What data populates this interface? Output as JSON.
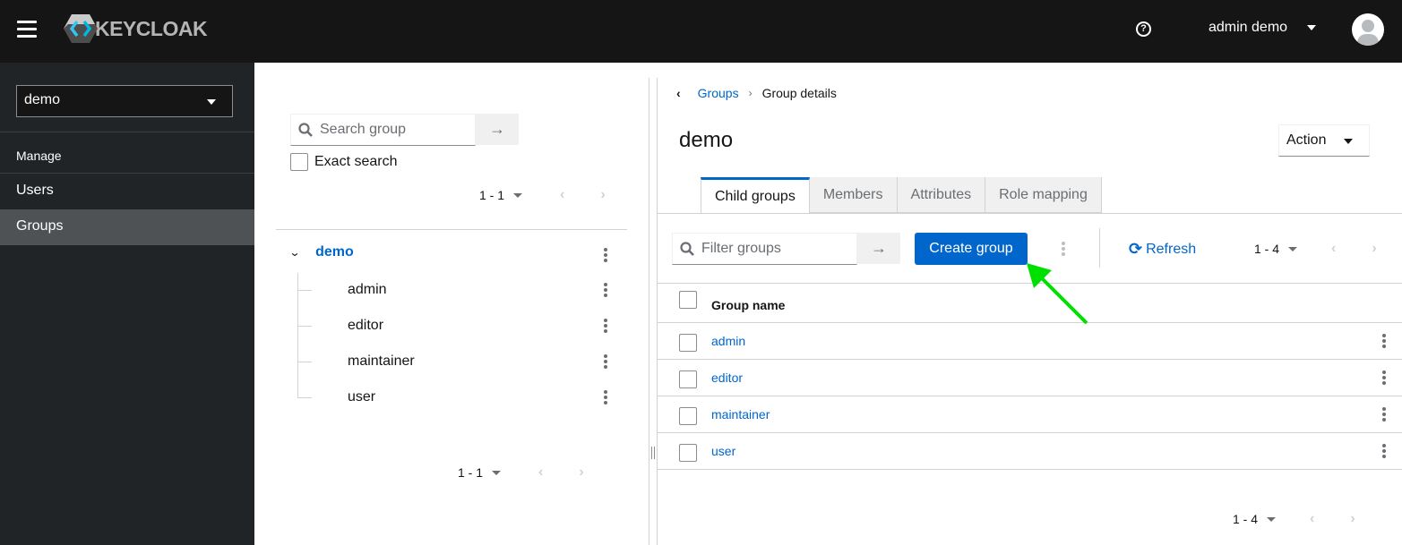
{
  "header": {
    "brand": "KEYCLOAK",
    "user_name": "admin demo"
  },
  "sidebar": {
    "realm": "demo",
    "section": "Manage",
    "items": [
      {
        "label": "Users",
        "active": false
      },
      {
        "label": "Groups",
        "active": true
      }
    ]
  },
  "tree": {
    "search_placeholder": "Search group",
    "exact_search_label": "Exact search",
    "pager_top": "1 - 1",
    "pager_bottom": "1 - 1",
    "root": "demo",
    "children": [
      "admin",
      "editor",
      "maintainer",
      "user"
    ]
  },
  "detail": {
    "breadcrumb": {
      "parent": "Groups",
      "current": "Group details"
    },
    "title": "demo",
    "action_label": "Action",
    "tabs": [
      {
        "label": "Child groups",
        "active": true
      },
      {
        "label": "Members",
        "active": false
      },
      {
        "label": "Attributes",
        "active": false
      },
      {
        "label": "Role mapping",
        "active": false
      }
    ],
    "filter_placeholder": "Filter groups",
    "create_label": "Create group",
    "refresh_label": "Refresh",
    "pager_top": "1 - 4",
    "pager_bottom": "1 - 4",
    "column_header": "Group name",
    "rows": [
      "admin",
      "editor",
      "maintainer",
      "user"
    ]
  },
  "annotation": {
    "arrow_color": "#00e000",
    "target": "Create group"
  },
  "colors": {
    "brand_blue": "#0066cc",
    "masthead": "#151515",
    "sidebar": "#212427"
  }
}
